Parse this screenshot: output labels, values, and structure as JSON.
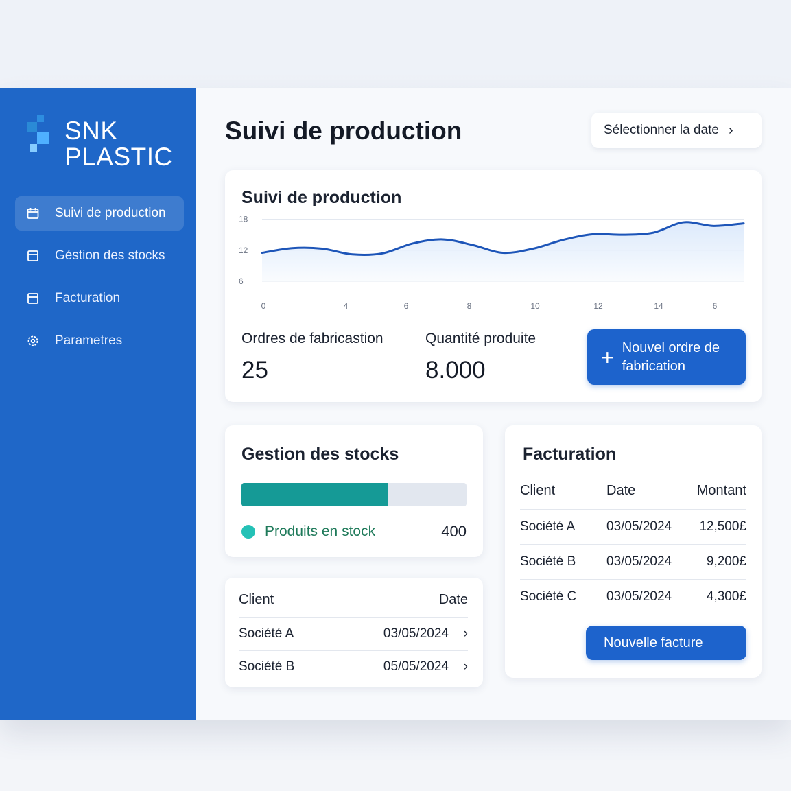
{
  "brand": {
    "line1": "SNK",
    "line2": "PLASTIC",
    "color": "#1f67c8"
  },
  "sidebar": {
    "items": [
      {
        "label": "Suivi de production",
        "icon": "calendar-icon",
        "active": true
      },
      {
        "label": "Géstion des stocks",
        "icon": "box-icon",
        "active": false
      },
      {
        "label": "Facturation",
        "icon": "invoice-icon",
        "active": false
      },
      {
        "label": "Parametres",
        "icon": "gear-icon",
        "active": false
      }
    ]
  },
  "header": {
    "title": "Suivi de production",
    "date_button": "Sélectionner la date"
  },
  "production": {
    "title": "Suivi de production",
    "orders_label": "Ordres de fabricastion",
    "orders_value": "25",
    "quantity_label": "Quantité produite",
    "quantity_value": "8.000",
    "new_order_button": "Nouvel ordre de fabrication"
  },
  "chart_data": {
    "type": "area",
    "x_tick_labels": [
      "0",
      "4",
      "6",
      "8",
      "10",
      "12",
      "14",
      "6"
    ],
    "y_tick_labels": [
      "18",
      "12",
      "6"
    ],
    "y_ticks": [
      18,
      12,
      6
    ],
    "ylim": [
      6,
      19
    ],
    "values": [
      11.5,
      12.4,
      12.3,
      11.2,
      11.4,
      13.3,
      14.1,
      13.0,
      11.5,
      12.3,
      14.0,
      15.1,
      15.0,
      15.4,
      17.4,
      16.7,
      17.2
    ],
    "grid": true,
    "line_color": "#1d55b8",
    "fill_color": "#dbe9fb"
  },
  "stock": {
    "title": "Gestion des stocks",
    "fill_fraction": 0.65,
    "legend_label": "Produits en stock",
    "legend_value": "400",
    "fill_color": "#159a96"
  },
  "clients": {
    "headers": [
      "Client",
      "Date"
    ],
    "rows": [
      {
        "client": "Société A",
        "date": "03/05/2024"
      },
      {
        "client": "Société B",
        "date": "05/05/2024"
      }
    ]
  },
  "billing": {
    "title": "Facturation",
    "headers": [
      "Client",
      "Date",
      "Montant"
    ],
    "rows": [
      {
        "client": "Société A",
        "date": "03/05/2024",
        "amount": "12,500£"
      },
      {
        "client": "Société B",
        "date": "03/05/2024",
        "amount": "9,200£"
      },
      {
        "client": "Société C",
        "date": "03/05/2024",
        "amount": "4,300£"
      }
    ],
    "new_invoice_button": "Nouvelle facture"
  }
}
